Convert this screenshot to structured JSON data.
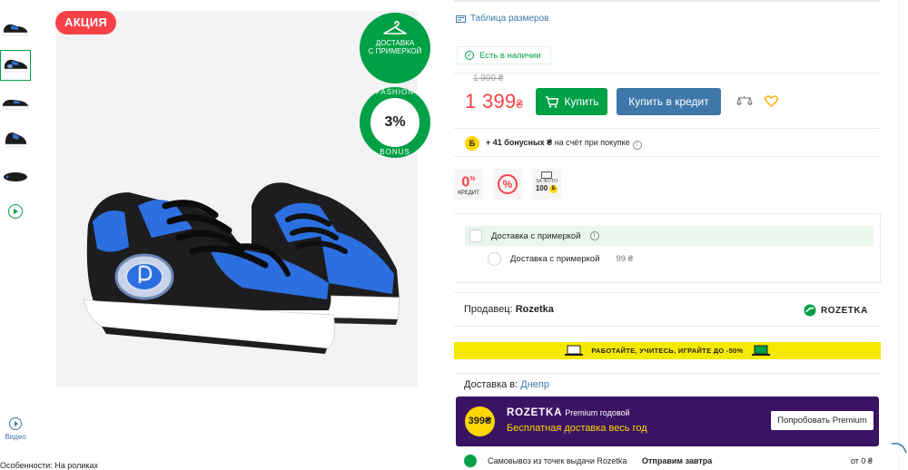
{
  "gallery": {
    "thumbnails": [
      {
        "name": "thumb-1",
        "active": false
      },
      {
        "name": "thumb-2",
        "active": true
      },
      {
        "name": "thumb-3",
        "active": false
      },
      {
        "name": "thumb-4",
        "active": false
      },
      {
        "name": "thumb-5",
        "active": false
      }
    ],
    "video_label": "Видео",
    "sale_badge": "АКЦИЯ",
    "try_badge": "ДОСТАВКА С ПРИМЕРКОЙ",
    "try_badge_line1": "ДОСТАВКА",
    "try_badge_line2": "С ПРИМЕРКОЙ",
    "bonus_badge_top": "FASHION",
    "bonus_badge_value": "3%",
    "bonus_badge_bottom": "BONUS"
  },
  "features_text": "Особенности: На роликах",
  "product": {
    "size_table_label": "Таблица размеров",
    "stock_label": "Есть в наличии",
    "old_price": "1 999 ₴",
    "price_value": "1 399",
    "price_currency": "₴",
    "buy_label": "Купить",
    "credit_label": "Купить в кредит",
    "bonus_prefix": "Б",
    "bonus_amount": "+ 41 бонусных ₴",
    "bonus_suffix": " на счёт при покупке",
    "promo": {
      "zero_credit_value": "0",
      "zero_credit_unit": "%",
      "zero_credit_label": "КРЕДИТ",
      "percent_label": "%",
      "photo_label": "ЗА ФОТО",
      "photo_bonus": "100",
      "photo_bonus_unit": "Б"
    }
  },
  "delivery": {
    "option1_label": "Доставка с примеркой",
    "option2_label": "Доставка с примеркой",
    "option2_price": "99 ₴"
  },
  "seller": {
    "prefix": "Продавец: ",
    "name": "Rozetka",
    "logo_text": "ROZETKA"
  },
  "banner": {
    "text": "РАБОТАЙТЕ, УЧИТЕСЬ, ИГРАЙТЕ ДО -50%"
  },
  "shipping": {
    "to_label": "Доставка в: ",
    "city": "Днепр",
    "premium": {
      "coin": "399₴",
      "title": "ROZETKA",
      "title_suffix": "Premium годовой",
      "subtitle": "Бесплатная доставка весь год",
      "button": "Попробовать Premium"
    },
    "pickup": {
      "label": "Самовывоз из точек выдачи Rozetka",
      "ship": "Отправим завтра",
      "cost": "от 0 ₴"
    }
  },
  "colors": {
    "green": "#00a046",
    "red": "#f84147",
    "blue": "#3e77aa",
    "premium_purple": "#3a1463",
    "yellow": "#f5e900"
  },
  "icons": [
    "hanger-icon",
    "check-icon",
    "cart-icon",
    "compare-icon",
    "heart-icon",
    "info-icon",
    "play-icon",
    "laptop-icon",
    "rozetka-logo-icon",
    "pickup-icon"
  ]
}
